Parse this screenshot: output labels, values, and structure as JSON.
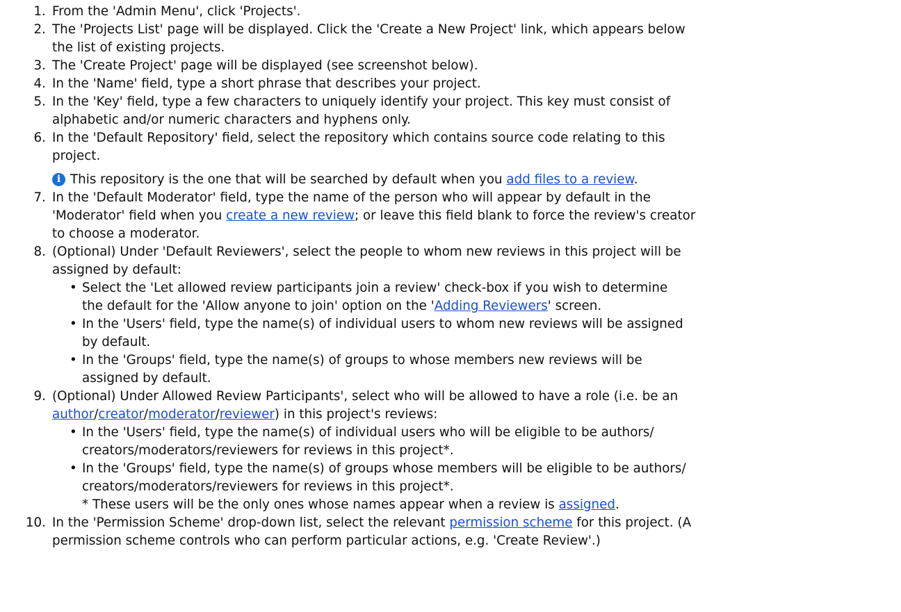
{
  "steps": [
    {
      "num": "1.",
      "lines": [
        "From the 'Admin Menu', click 'Projects'."
      ]
    },
    {
      "num": "2.",
      "lines": [
        "The 'Projects List' page will be displayed. Click the 'Create a New Project' link, which appears below",
        "the list of existing projects."
      ]
    },
    {
      "num": "3.",
      "lines": [
        "The 'Create Project' page will be displayed (see screenshot below)."
      ]
    },
    {
      "num": "4.",
      "lines": [
        "In the 'Name' field, type a short phrase that describes your project."
      ]
    },
    {
      "num": "5.",
      "lines": [
        "In the 'Key' field, type a few characters to uniquely identify your project. This key must consist of",
        "alphabetic and/or numeric characters and hyphens only."
      ]
    },
    {
      "num": "6.",
      "lines": [
        "In the 'Default Repository' field, select the repository which contains source code relating to this",
        "project."
      ]
    },
    {
      "num": "7.",
      "line1": "In the 'Default Moderator' field, type the name of the person who will appear by default in the",
      "line2_pre": "'Moderator' field when you ",
      "line2_link": "create a new review",
      "line2_post": "; or leave this field blank to force the review's creator",
      "line3": "to choose a moderator."
    },
    {
      "num": "8.",
      "lines": [
        "(Optional) Under 'Default Reviewers', select the people to whom new reviews in this project will be",
        "assigned by default:"
      ]
    },
    {
      "num": "9.",
      "line1": "(Optional) Under Allowed Review Participants', select who will be allowed to have a role (i.e. be an",
      "link_author": "author",
      "link_creator": "creator",
      "link_moderator": "moderator",
      "link_reviewer": "reviewer",
      "line2_post": ") in this project's reviews:"
    },
    {
      "num": "10.",
      "line1_pre": "In the 'Permission Scheme' drop-down list, select the relevant ",
      "line1_link": "permission scheme",
      "line1_post": " for this project. (A",
      "line2": "permission scheme controls who can perform particular actions, e.g. 'Create Review'.)"
    }
  ],
  "note": {
    "icon": "info-icon",
    "pre": "This repository is the one that will be searched by default when you ",
    "link": "add files to a review",
    "post": "."
  },
  "step8_bullets": {
    "b1_line1": "Select the 'Let allowed review participants join a review' check-box if you wish to determine",
    "b1_line2_pre": "the default for the 'Allow anyone to join' option on the '",
    "b1_line2_link": "Adding Reviewers",
    "b1_line2_post": "' screen.",
    "b2_line1": "In the 'Users' field, type the name(s) of individual users to whom new reviews will be assigned",
    "b2_line2": "by default.",
    "b3_line1": "In the 'Groups' field, type the name(s) of groups to whose members new reviews will be",
    "b3_line2": "assigned by default."
  },
  "step9_bullets": {
    "b1_line1": "In the 'Users' field, type the name(s) of individual users who will be eligible to be authors/",
    "b1_line2": "creators/moderators/reviewers for reviews in this project*.",
    "b2_line1": "In the 'Groups' field, type the name(s) of groups whose members will be eligible to be authors/",
    "b2_line2": "creators/moderators/reviewers for reviews in this project*.",
    "footnote_pre": "* These users will be the only ones whose names appear when a review is ",
    "footnote_link": "assigned",
    "footnote_post": "."
  },
  "bullet_char": "•",
  "slash": "/"
}
